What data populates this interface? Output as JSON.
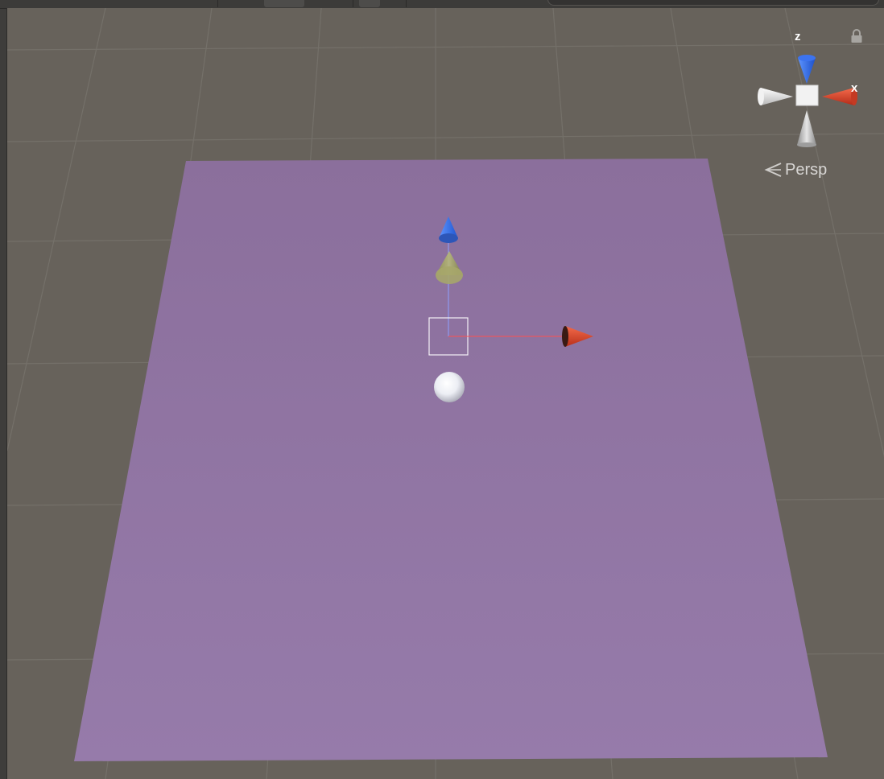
{
  "scene_view": {
    "gizmo": {
      "z_label": "z",
      "x_label": "x",
      "projection_label": "Persp",
      "lock": "lock-icon",
      "projection_icon": "perspective-chevron-icon"
    }
  },
  "colors": {
    "background": "#67625b",
    "plane": "#8f74a0",
    "axis_x": "#e0472b",
    "axis_y": "#9ea05a",
    "axis_z": "#2f6fe8",
    "selection": "#ffffff"
  }
}
